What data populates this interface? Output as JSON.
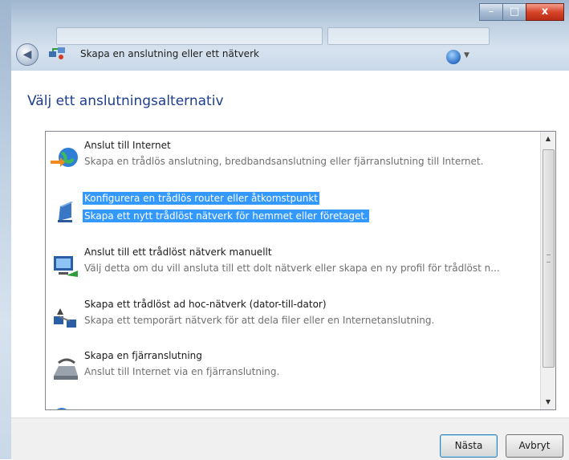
{
  "window": {
    "title": "Skapa en anslutning eller ett nätverk",
    "controls": {
      "minimize": "–",
      "maximize": "□",
      "close": "x"
    }
  },
  "nav": {
    "back_icon": "back-arrow-icon",
    "help_icon": "help-icon"
  },
  "page": {
    "heading": "Välj ett anslutningsalternativ"
  },
  "options": [
    {
      "title": "Anslut till Internet",
      "description": "Skapa en trådlös anslutning, bredbandsanslutning eller fjärranslutning till Internet.",
      "icon": "globe-icon",
      "selected": false
    },
    {
      "title": "Konfigurera en trådlös router eller åtkomstpunkt",
      "description": "Skapa ett nytt trådlöst nätverk för hemmet eller företaget.",
      "icon": "router-icon",
      "selected": true
    },
    {
      "title": "Anslut till ett trådlöst nätverk manuellt",
      "description": "Välj detta om du vill ansluta till ett dolt nätverk eller skapa en ny profil för trådlöst n...",
      "icon": "wireless-network-icon",
      "selected": false
    },
    {
      "title": "Skapa ett trådlöst ad hoc-nätverk (dator-till-dator)",
      "description": "Skapa ett temporärt nätverk för att dela filer eller en Internetanslutning.",
      "icon": "adhoc-network-icon",
      "selected": false
    },
    {
      "title": "Skapa en fjärranslutning",
      "description": "Anslut till Internet via en fjärranslutning.",
      "icon": "modem-icon",
      "selected": false
    }
  ],
  "buttons": {
    "next": "Nästa",
    "cancel": "Avbryt"
  },
  "colors": {
    "heading": "#1d3f8c",
    "selection": "#3399ff"
  }
}
